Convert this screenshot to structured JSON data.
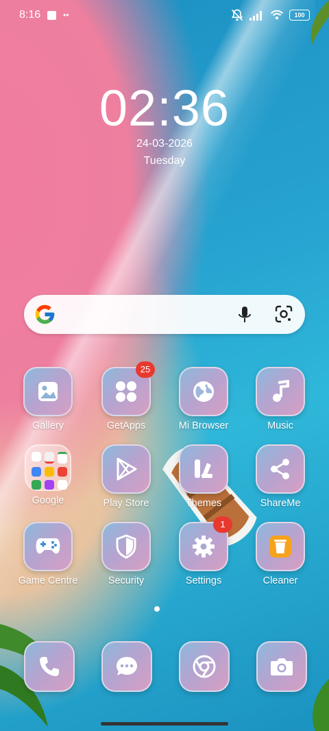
{
  "status_bar": {
    "time": "8:16",
    "battery": "100"
  },
  "lock_widget": {
    "clock": "02:36",
    "date": "24-03-2026",
    "weekday": "Tuesday"
  },
  "search_bar": {
    "icons": [
      "google-logo",
      "mic-icon",
      "lens-icon"
    ]
  },
  "apps": [
    {
      "label": "Gallery",
      "icon": "gallery-icon"
    },
    {
      "label": "GetApps",
      "icon": "getapps-icon",
      "badge": "25"
    },
    {
      "label": "Mi Browser",
      "icon": "globe-icon"
    },
    {
      "label": "Music",
      "icon": "music-note-icon"
    },
    {
      "label": "Google",
      "icon": "google-folder-icon"
    },
    {
      "label": "Play Store",
      "icon": "play-store-icon"
    },
    {
      "label": "Themes",
      "icon": "themes-icon"
    },
    {
      "label": "ShareMe",
      "icon": "share-icon"
    },
    {
      "label": "Game Centre",
      "icon": "gamepad-icon"
    },
    {
      "label": "Security",
      "icon": "shield-icon"
    },
    {
      "label": "Settings",
      "icon": "gear-icon",
      "badge": "1"
    },
    {
      "label": "Cleaner",
      "icon": "trash-icon"
    }
  ],
  "dock": [
    {
      "icon": "phone-icon"
    },
    {
      "icon": "message-icon"
    },
    {
      "icon": "chrome-icon"
    },
    {
      "icon": "camera-icon"
    }
  ],
  "colors": {
    "badge": "#e8392f",
    "cleaner_icon": "#f7a21b"
  }
}
